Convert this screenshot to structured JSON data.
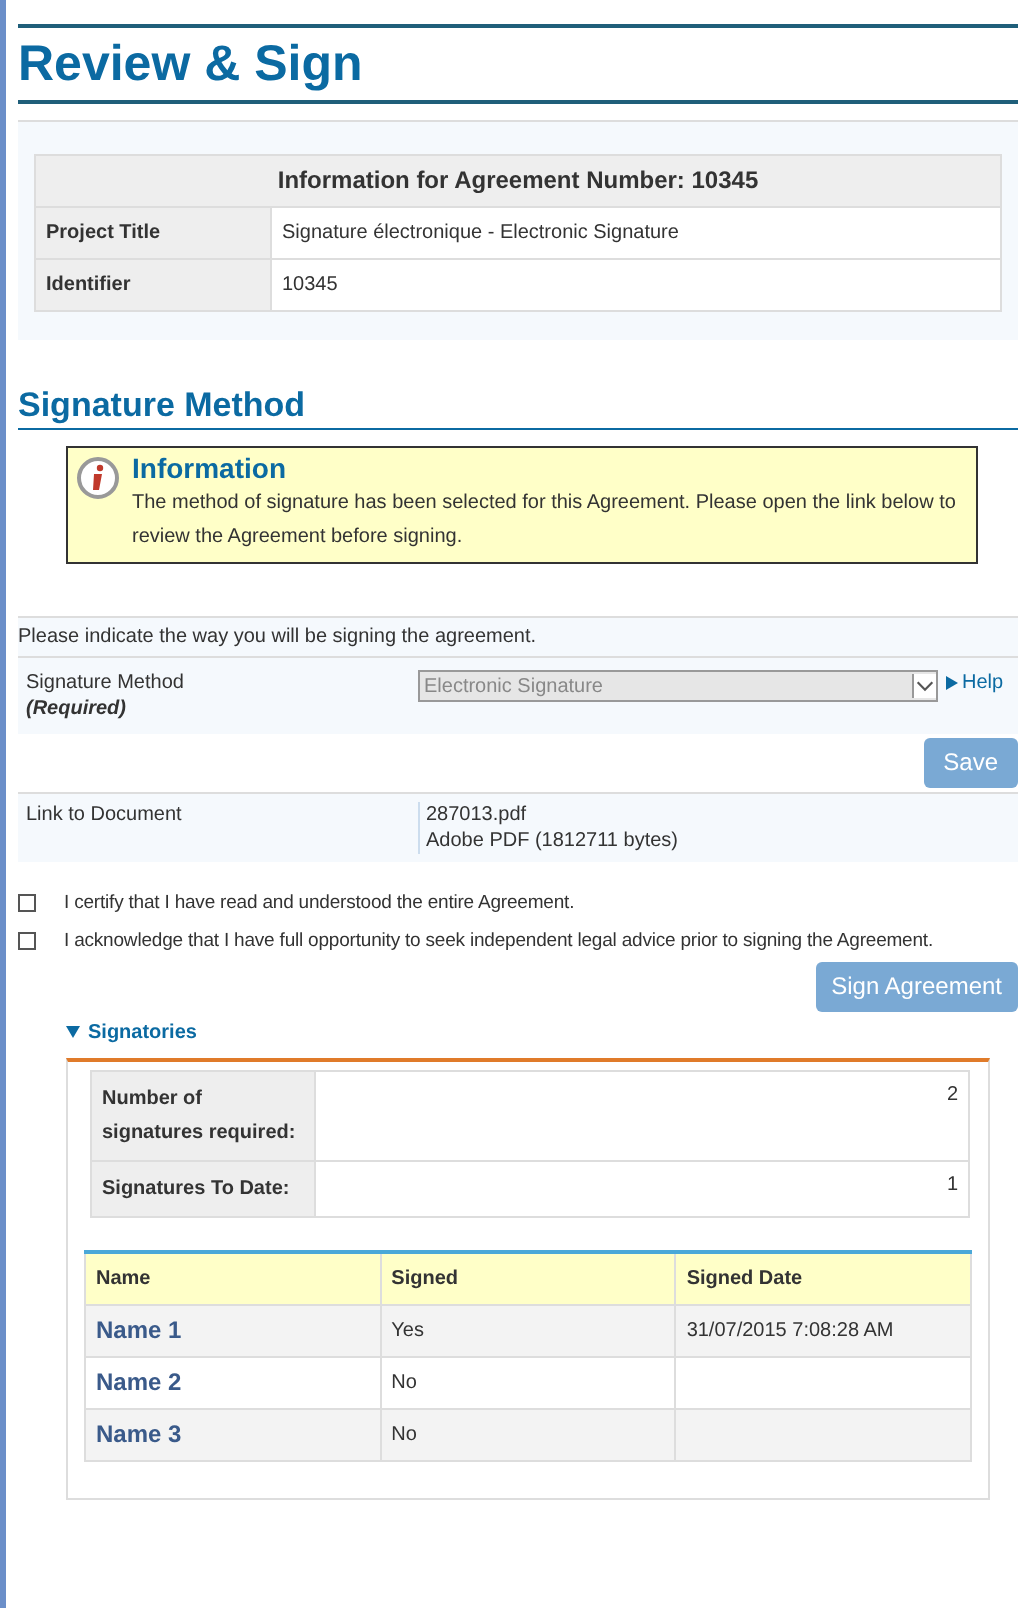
{
  "page_title": "Review & Sign",
  "agreement_info": {
    "heading": "Information for Agreement Number: 10345",
    "rows": [
      {
        "label": "Project Title",
        "value": "Signature électronique - Electronic Signature"
      },
      {
        "label": "Identifier",
        "value": "10345"
      }
    ]
  },
  "signature_section": {
    "heading": "Signature Method",
    "notice": {
      "title": "Information",
      "text": "The method of signature has been selected for this Agreement. Please open the link below to review the Agreement before signing."
    },
    "instruction": "Please indicate the way you will be signing the agreement.",
    "method_label": "Signature Method",
    "required_label": "(Required)",
    "method_value": "Electronic Signature",
    "help_link": "Help",
    "save_button": "Save",
    "document_label": "Link to Document",
    "document_name": "287013.pdf",
    "document_info": "Adobe PDF (1812711 bytes)"
  },
  "declarations": [
    {
      "text": "I certify that I have read and understood the entire Agreement.",
      "checked": false
    },
    {
      "text": "I acknowledge that I have full opportunity to seek independent legal advice prior to signing the Agreement.",
      "checked": false
    }
  ],
  "sign_button": "Sign Agreement",
  "signatories": {
    "title": "Signatories",
    "expanded": true,
    "summary": [
      {
        "label": "Number of signatures required:",
        "value": "2"
      },
      {
        "label": "Signatures To Date:",
        "value": "1"
      }
    ],
    "columns": [
      "Name",
      "Signed",
      "Signed Date"
    ],
    "rows": [
      {
        "name": "Name 1",
        "signed": "Yes",
        "date": "31/07/2015 7:08:28 AM"
      },
      {
        "name": "Name 2",
        "signed": "No"
      },
      {
        "name": "Name 3",
        "signed": "No"
      }
    ]
  }
}
